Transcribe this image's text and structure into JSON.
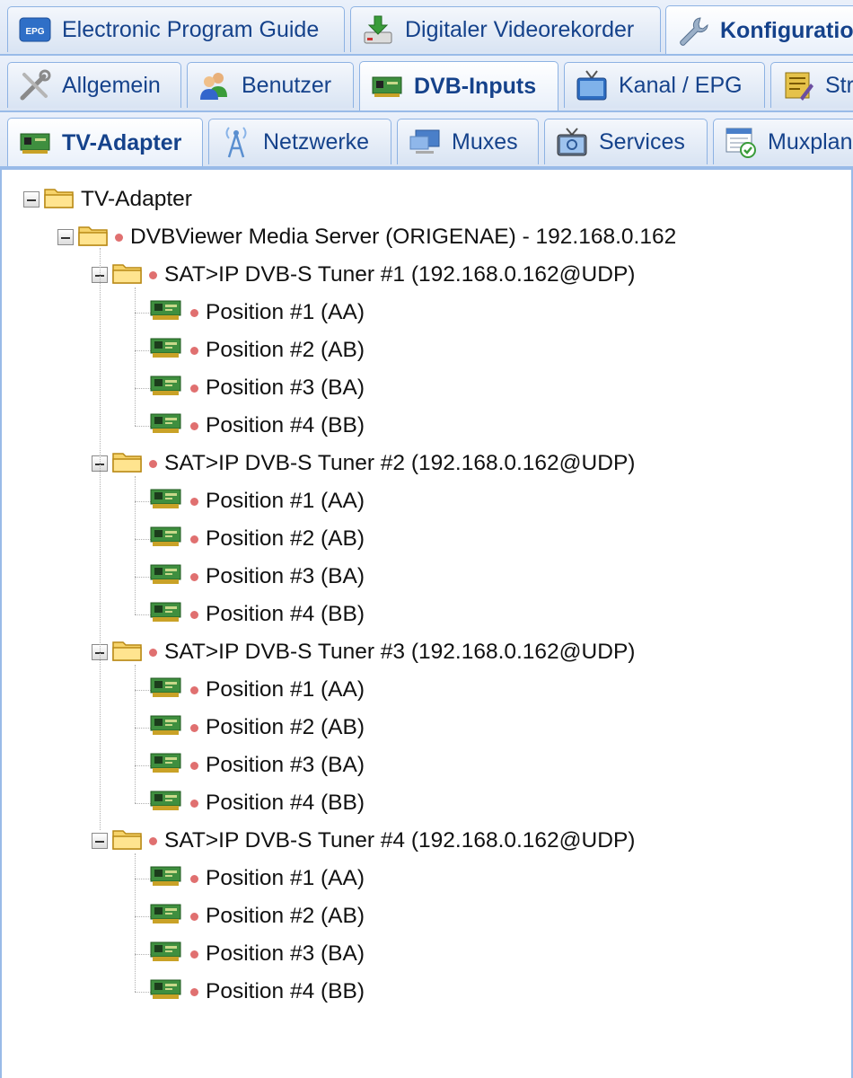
{
  "top_tabs": [
    {
      "label": "Electronic Program Guide",
      "icon": "epg-icon",
      "active": false
    },
    {
      "label": "Digitaler Videorekorder",
      "icon": "download-icon",
      "active": false
    },
    {
      "label": "Konfiguratio",
      "icon": "wrench-icon",
      "active": true
    }
  ],
  "config_tabs": [
    {
      "label": "Allgemein",
      "icon": "tools-icon",
      "active": false
    },
    {
      "label": "Benutzer",
      "icon": "users-icon",
      "active": false
    },
    {
      "label": "DVB-Inputs",
      "icon": "tv-card-icon",
      "active": true
    },
    {
      "label": "Kanal / EPG",
      "icon": "television-icon",
      "active": false
    },
    {
      "label": "Str",
      "icon": "stream-icon",
      "active": false
    }
  ],
  "dvb_tabs": [
    {
      "label": "TV-Adapter",
      "icon": "tv-card-icon",
      "active": true
    },
    {
      "label": "Netzwerke",
      "icon": "antenna-icon",
      "active": false
    },
    {
      "label": "Muxes",
      "icon": "monitor-icon",
      "active": false
    },
    {
      "label": "Services",
      "icon": "tv-service-icon",
      "active": false
    },
    {
      "label": "Muxplan",
      "icon": "scheduler-icon",
      "active": false
    }
  ],
  "tree": {
    "root": "TV-Adapter",
    "server": "DVBViewer Media Server (ORIGENAE) - 192.168.0.162",
    "tuners": [
      {
        "label": "SAT>IP DVB-S Tuner #1 (192.168.0.162@UDP)",
        "positions": [
          "Position #1 (AA)",
          "Position #2 (AB)",
          "Position #3 (BA)",
          "Position #4 (BB)"
        ]
      },
      {
        "label": "SAT>IP DVB-S Tuner #2 (192.168.0.162@UDP)",
        "positions": [
          "Position #1 (AA)",
          "Position #2 (AB)",
          "Position #3 (BA)",
          "Position #4 (BB)"
        ]
      },
      {
        "label": "SAT>IP DVB-S Tuner #3 (192.168.0.162@UDP)",
        "positions": [
          "Position #1 (AA)",
          "Position #2 (AB)",
          "Position #3 (BA)",
          "Position #4 (BB)"
        ]
      },
      {
        "label": "SAT>IP DVB-S Tuner #4 (192.168.0.162@UDP)",
        "positions": [
          "Position #1 (AA)",
          "Position #2 (AB)",
          "Position #3 (BA)",
          "Position #4 (BB)"
        ]
      }
    ]
  },
  "colors": {
    "status_dot": "#e07070",
    "tab_text": "#15428b",
    "tab_border": "#99bbe8"
  }
}
